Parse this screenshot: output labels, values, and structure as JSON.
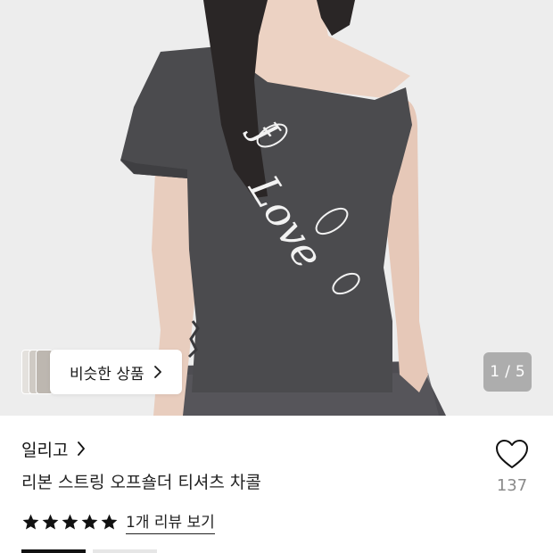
{
  "gallery": {
    "current_page": "1",
    "separator": "/",
    "total_pages": "5",
    "print_text": "Love",
    "similar_label": "비슷한 상품"
  },
  "product": {
    "brand": "일리고",
    "name": "리본 스트링 오프숄더 티셔츠 차콜",
    "like_count": "137",
    "rating": 5,
    "review_link": "1개 리뷰 보기"
  },
  "icons": {
    "brand_chevron": "chevron-right-icon",
    "similar_chevron": "chevron-right-icon",
    "like": "heart-outline-icon",
    "star": "star-filled-icon"
  },
  "colors": {
    "star": "#111111",
    "like_count": "#8a8a8a",
    "shirt": "#4a4a4c"
  }
}
